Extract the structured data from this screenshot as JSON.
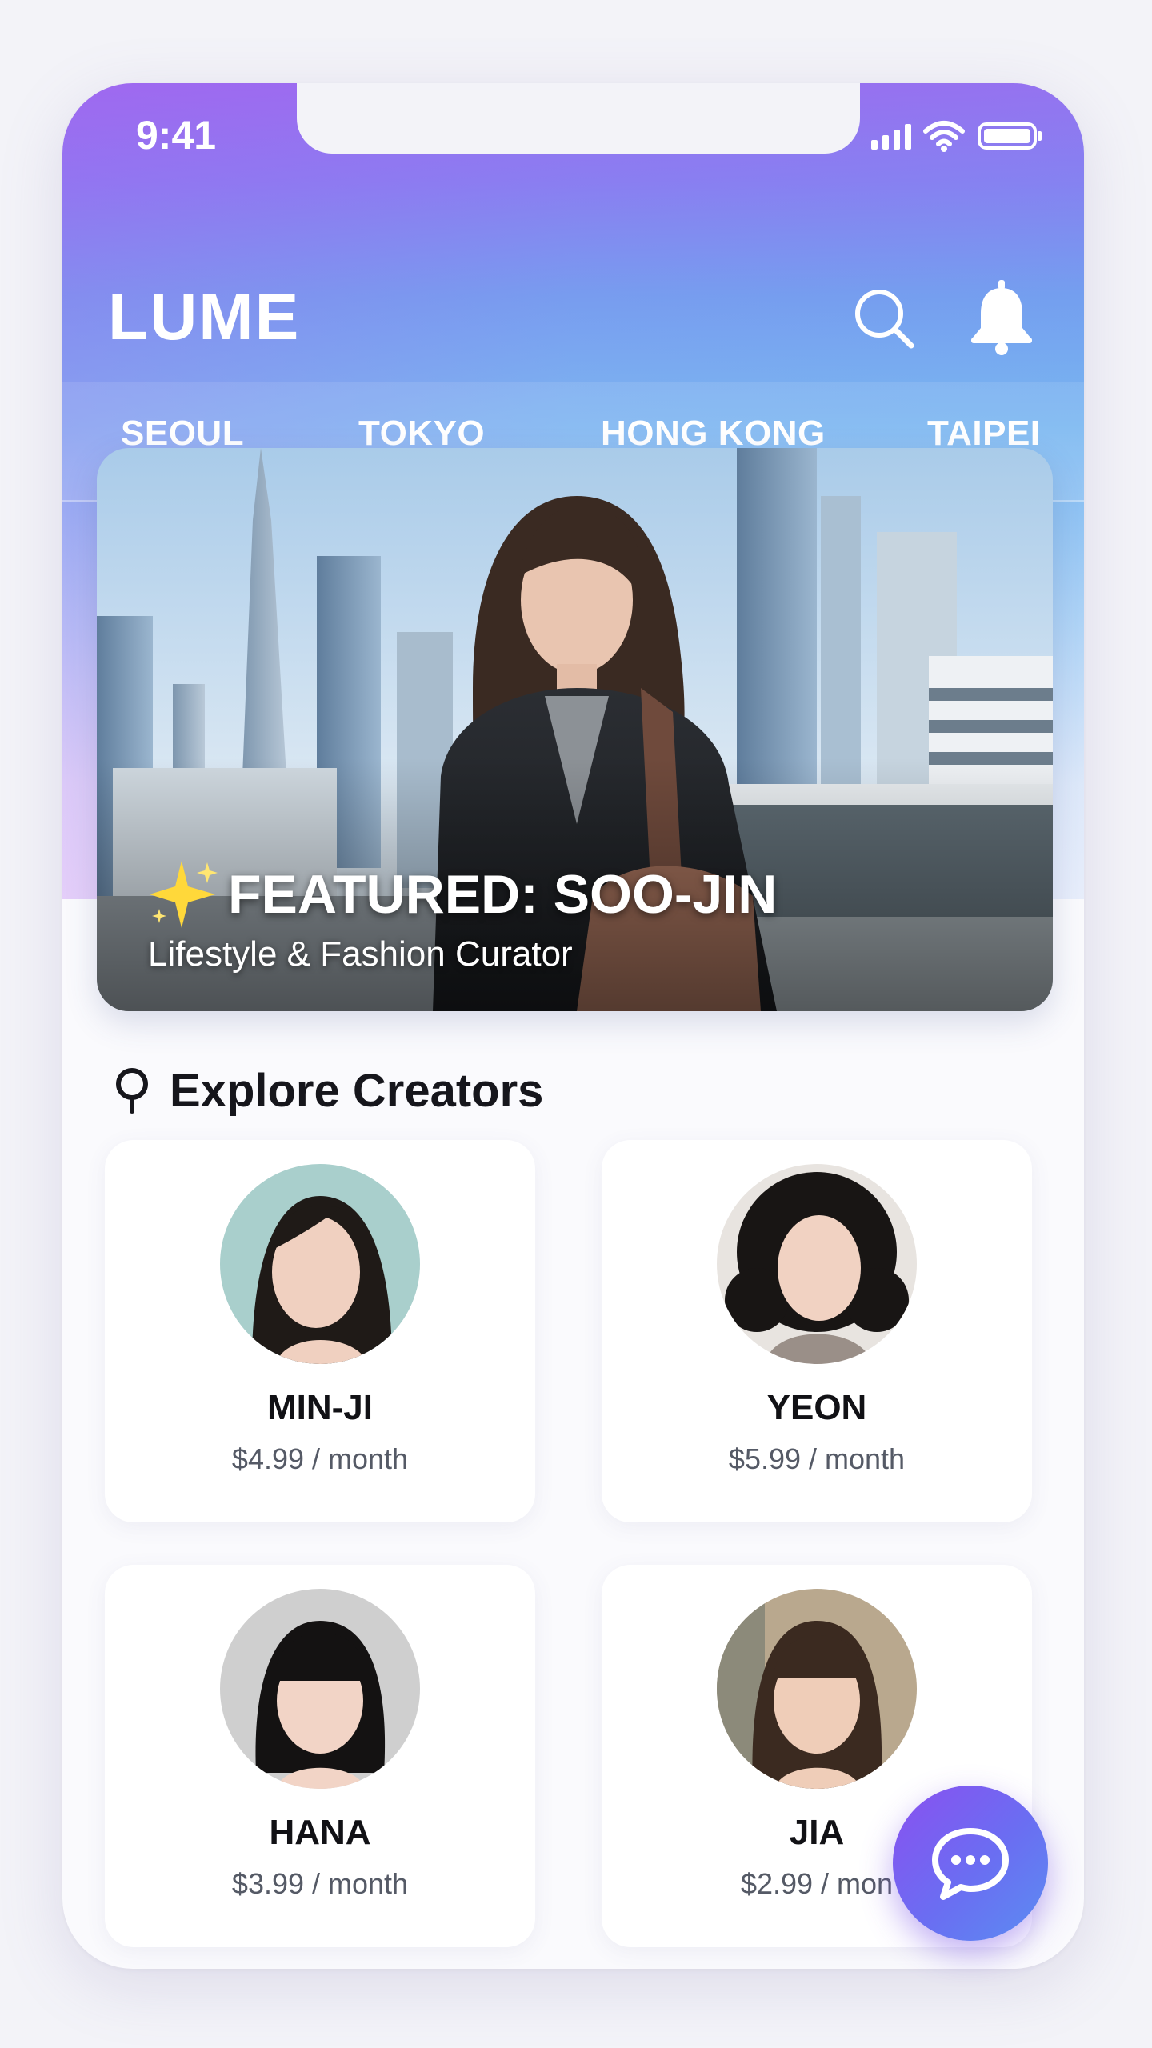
{
  "status_bar": {
    "time": "9:41",
    "icons": [
      "signal-icon",
      "wifi-icon",
      "battery-icon"
    ]
  },
  "header": {
    "logo": "LUME",
    "icons": [
      "search-icon",
      "bell-icon"
    ]
  },
  "tabs": [
    {
      "label": "SEOUL",
      "active": true
    },
    {
      "label": "TOKYO",
      "active": false
    },
    {
      "label": "HONG KONG",
      "active": false
    },
    {
      "label": "TAIPEI",
      "active": false
    }
  ],
  "featured": {
    "title": "FEATURED: SOO-JIN",
    "subtitle": "Lifestyle & Fashion Curator",
    "icon": "sparkle-icon"
  },
  "section": {
    "title": "Explore Creators",
    "icon": "location-pin-icon"
  },
  "creators": [
    {
      "name": "MIN-JI",
      "price": "$4.99 / month"
    },
    {
      "name": "YEON",
      "price": "$5.99 / month"
    },
    {
      "name": "HANA",
      "price": "$3.99 / month"
    },
    {
      "name": "JIA",
      "price": "$2.99 / mon"
    }
  ],
  "fab": {
    "icon": "chat-icon"
  },
  "colors": {
    "accent": "#7b3fe4",
    "gradient_top": "#9b6ef0",
    "gradient_mid": "#76a0ef",
    "fab": "#6a6ef2"
  }
}
